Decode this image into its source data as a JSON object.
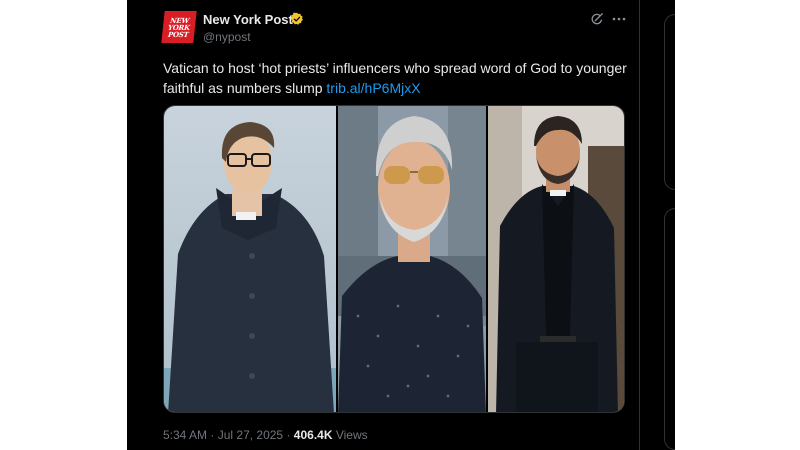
{
  "tweet": {
    "author": {
      "avatar_lines": [
        "NEW",
        "YORK",
        "POST"
      ],
      "display_name": "New York Post",
      "handle": "@nypost",
      "verified": true
    },
    "text": "Vatican to host ‘hot priests’ influencers who spread word of God to younger faithful as numbers slump",
    "link": "trib.al/hP6MjxX",
    "media": [
      {
        "icon": "photo-man-glasses-dark-coat"
      },
      {
        "icon": "photo-man-grey-hair-sunglasses"
      },
      {
        "icon": "photo-man-beard-black-suit"
      }
    ],
    "time": "5:34 AM",
    "date": "Jul 27, 2025",
    "separator": "·",
    "views_count": "406.4K",
    "views_label": "Views"
  },
  "colors": {
    "background": "#000000",
    "text": "#e7e9ea",
    "secondary": "#71767b",
    "link": "#1d9bf0",
    "brand_red": "#d91d25",
    "verified_gold": "#f4c430"
  }
}
